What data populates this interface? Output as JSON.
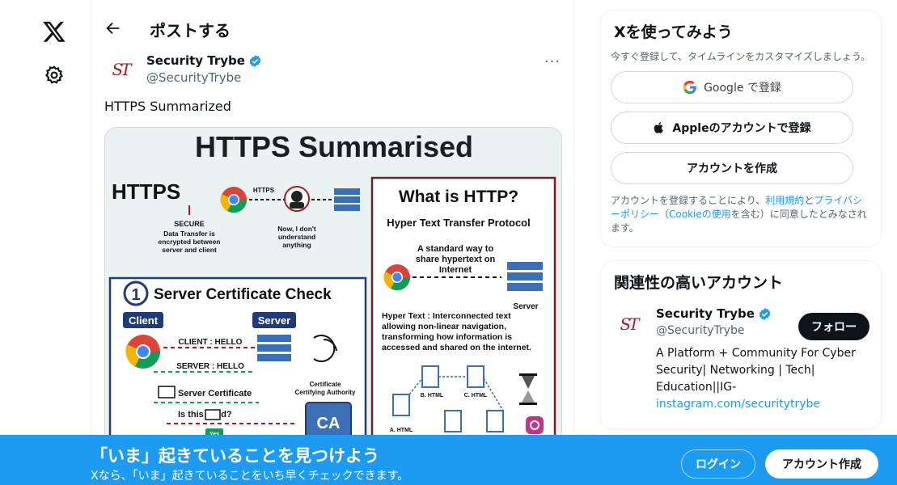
{
  "nav": {
    "logo_icon": "x-logo-icon",
    "settings_icon": "gear-icon"
  },
  "header": {
    "title": "ポストする"
  },
  "post": {
    "author_name": "Security Trybe",
    "author_handle": "@SecurityTrybe",
    "avatar_text": "ST",
    "more": "···",
    "text": "HTTPS Summarized",
    "image": {
      "title": "HTTPS Summarised",
      "https_label": "HTTPS",
      "arrow_label": "HTTPS",
      "secure": "SECURE",
      "secure_desc": [
        "Data Transfer is",
        "encrypted between",
        "server and client"
      ],
      "hacker_desc": [
        "Now, I don't",
        "understand",
        "anything"
      ],
      "what_http": "What is HTTP?",
      "http_full": "Hyper Text Transfer Protocol",
      "http_desc": [
        "A standard way to",
        "share hypertext on",
        "Internet"
      ],
      "server": "Server",
      "hypertext_desc": [
        "Hyper Text : Interconnected text",
        "allowing non-linear navigation,",
        "transforming how information is",
        "accessed and shared on the internet."
      ],
      "step_num": "1",
      "cert_title": "Server Certificate Check",
      "client": "Client",
      "server2": "Server",
      "client_hello": "CLIENT : HELLO",
      "server_hello": "SERVER : HELLO",
      "server_cert": "Server Certificate",
      "is_valid": "Is this     valid?",
      "ca_label": [
        "Certificate",
        "Certifying Authority"
      ],
      "ca": "CA",
      "yes": "Yes",
      "html_a": "A. HTML",
      "html_b": "B. HTML",
      "html_c": "C. HTML"
    }
  },
  "sidebar": {
    "join": {
      "title": "Xを使ってみよう",
      "subtitle": "今すぐ登録して、タイムラインをカスタマイズしましょう。",
      "google_label": "Google で登録",
      "apple_label": "Appleのアカウントで登録",
      "create_label": "アカウントを作成",
      "legal_pre": "アカウントを登録することにより、",
      "terms": "利用規約",
      "and": "と",
      "privacy": "プライバシーポリシー",
      "paren_open": "（",
      "cookie": "Cookieの使用",
      "legal_post": "を含む）に同意したとみなされます。"
    },
    "related": {
      "title": "関連性の高いアカウント",
      "name": "Security Trybe",
      "handle": "@SecurityTrybe",
      "follow": "フォロー",
      "bio_pre": "A Platform + Community For Cyber Security| Networking | Tech| Education||IG-",
      "bio_link": "instagram.com/securitytrybe"
    }
  },
  "bottom": {
    "headline": "「いま」起きていることを見つけよう",
    "sub": "Xなら、「いま」起きていることをいち早くチェックできます。",
    "login": "ログイン",
    "signup": "アカウント作成"
  },
  "colors": {
    "accent": "#1d9bf0",
    "text": "#0f1419",
    "muted": "#536471",
    "brand_red": "#a31d24"
  }
}
